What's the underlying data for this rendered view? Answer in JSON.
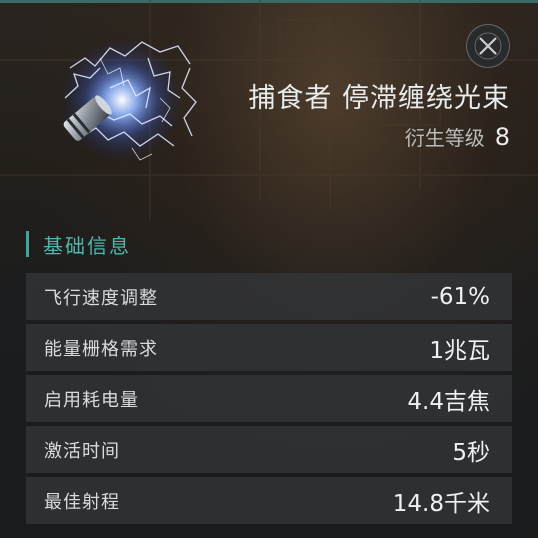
{
  "header": {
    "item_name": "捕食者 停滞缠绕光束",
    "meta_label": "衍生等级",
    "meta_level": "8",
    "close_icon": "close-x-icon",
    "item_icon": "stasis-webifier-icon"
  },
  "section": {
    "title": "基础信息"
  },
  "attributes": [
    {
      "name": "飞行速度调整",
      "value": "-61%"
    },
    {
      "name": "能量栅格需求",
      "value": "1兆瓦"
    },
    {
      "name": "启用耗电量",
      "value": "4.4吉焦"
    },
    {
      "name": "激活时间",
      "value": "5秒"
    },
    {
      "name": "最佳射程",
      "value": "14.8千米"
    }
  ],
  "colors": {
    "accent": "#4fb7ae",
    "top_line": "#3c6a66",
    "row_bg": "#34383a"
  }
}
